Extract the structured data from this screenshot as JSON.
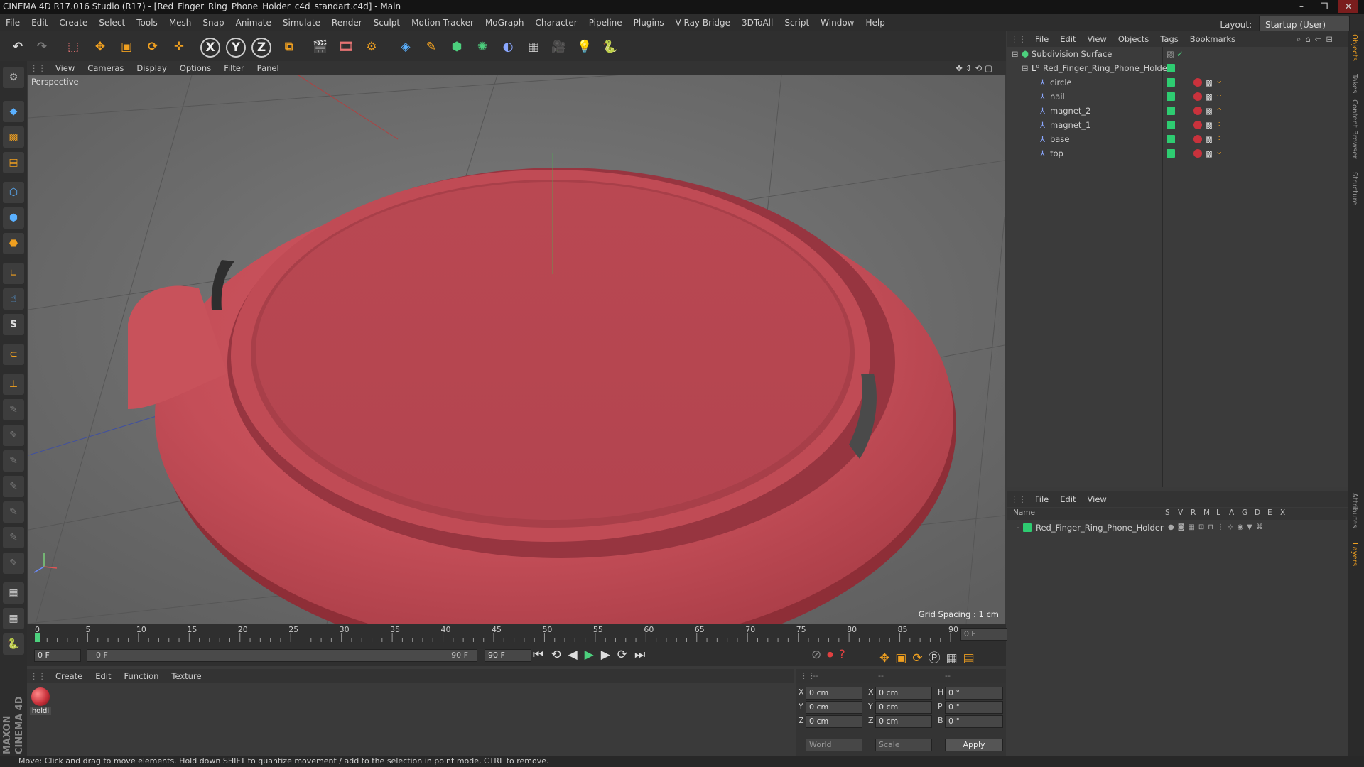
{
  "window": {
    "title": "CINEMA 4D R17.016 Studio (R17) - [Red_Finger_Ring_Phone_Holder_c4d_standart.c4d] - Main",
    "min": "–",
    "max": "❐",
    "close": "✕"
  },
  "menubar": {
    "items": [
      "File",
      "Edit",
      "Create",
      "Select",
      "Tools",
      "Mesh",
      "Snap",
      "Animate",
      "Simulate",
      "Render",
      "Sculpt",
      "Motion Tracker",
      "MoGraph",
      "Character",
      "Pipeline",
      "Plugins",
      "V-Ray Bridge",
      "3DToAll",
      "Script",
      "Window",
      "Help"
    ],
    "layout_label": "Layout:",
    "layout_value": "Startup (User)"
  },
  "viewport": {
    "menu": [
      "View",
      "Cameras",
      "Display",
      "Options",
      "Filter",
      "Panel"
    ],
    "label": "Perspective",
    "grid_spacing": "Grid Spacing : 1 cm",
    "object_color": "#c94b55"
  },
  "timeline": {
    "ticks": [
      "0",
      "5",
      "10",
      "15",
      "20",
      "25",
      "30",
      "35",
      "40",
      "45",
      "50",
      "55",
      "60",
      "65",
      "70",
      "75",
      "80",
      "85",
      "90"
    ],
    "frame_end_field": "0 F",
    "start_field": "0 F",
    "range_start": "0 F",
    "range_end": "90 F",
    "end_field": "90 F"
  },
  "material_manager": {
    "menu": [
      "Create",
      "Edit",
      "Function",
      "Texture"
    ],
    "materials": [
      {
        "name": "holdi",
        "color": "#c9323c"
      }
    ]
  },
  "coordinates": {
    "header": [
      "--",
      "--",
      "--"
    ],
    "rows": [
      {
        "a": "X",
        "av": "0 cm",
        "b": "X",
        "bv": "0 cm",
        "c": "H",
        "cv": "0 °"
      },
      {
        "a": "Y",
        "av": "0 cm",
        "b": "Y",
        "bv": "0 cm",
        "c": "P",
        "cv": "0 °"
      },
      {
        "a": "Z",
        "av": "0 cm",
        "b": "Z",
        "bv": "0 cm",
        "c": "B",
        "cv": "0 °"
      }
    ],
    "world": "World",
    "scale": "Scale",
    "apply": "Apply"
  },
  "object_manager": {
    "menu": [
      "File",
      "Edit",
      "View",
      "Objects",
      "Tags",
      "Bookmarks"
    ],
    "objects": [
      {
        "name": "Subdivision Surface",
        "level": 0
      },
      {
        "name": "Red_Finger_Ring_Phone_Holder",
        "level": 1
      },
      {
        "name": "circle",
        "level": 2
      },
      {
        "name": "nail",
        "level": 2
      },
      {
        "name": "magnet_2",
        "level": 2
      },
      {
        "name": "magnet_1",
        "level": 2
      },
      {
        "name": "base",
        "level": 2
      },
      {
        "name": "top",
        "level": 2
      }
    ]
  },
  "layer_manager": {
    "menu": [
      "File",
      "Edit",
      "View"
    ],
    "columns": [
      "Name",
      "S",
      "V",
      "R",
      "M",
      "L",
      "A",
      "G",
      "D",
      "E",
      "X"
    ],
    "layers": [
      {
        "name": "Red_Finger_Ring_Phone_Holder",
        "color": "#2ecc71"
      }
    ]
  },
  "side_tabs": [
    "Objects",
    "Takes",
    "Content Browser",
    "Structure",
    "Attributes",
    "Layers"
  ],
  "status": "Move: Click and drag to move elements. Hold down SHIFT to quantize movement / add to the selection in point mode, CTRL to remove.",
  "maxon_logo": "MAXON CINEMA 4D"
}
